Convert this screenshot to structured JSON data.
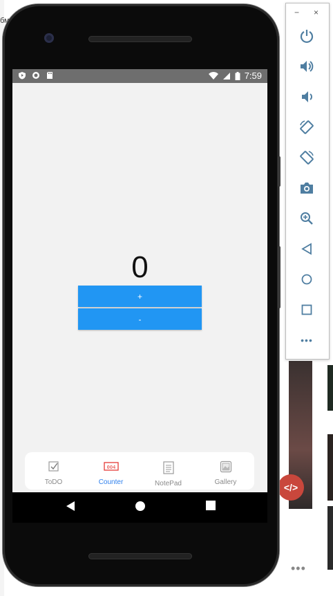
{
  "background": {
    "text": "бмена"
  },
  "status_bar": {
    "time": "7:59"
  },
  "counter": {
    "value": "0",
    "plus_label": "+",
    "minus_label": "-"
  },
  "tabs": [
    {
      "label": "ToDO",
      "icon": "checkbox-icon",
      "active": false
    },
    {
      "label": "Counter",
      "icon": "counter-icon",
      "active": true
    },
    {
      "label": "NotePad",
      "icon": "notepad-icon",
      "active": false
    },
    {
      "label": "Gallery",
      "icon": "gallery-icon",
      "active": false
    }
  ],
  "emulator": {
    "minimize_label": "−",
    "close_label": "×",
    "more_label": "•••"
  },
  "colors": {
    "accent": "#2196f3",
    "active_tab": "#2f80ed",
    "status_bar": "#6e6e6e",
    "screen_bg": "#f2f2f2",
    "emulator_icon": "#4f7ea1"
  }
}
